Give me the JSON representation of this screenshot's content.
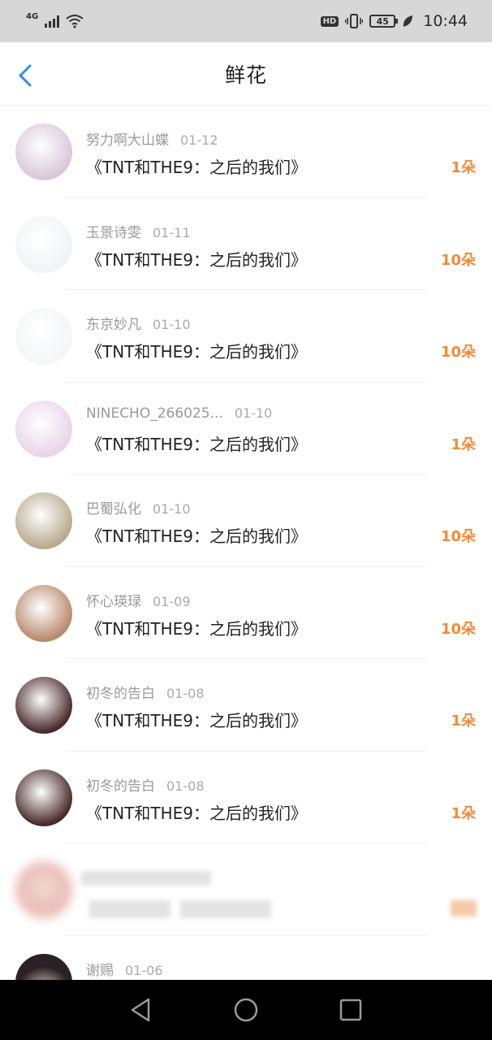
{
  "status_bar": {
    "network": "4G",
    "hd": "HD",
    "battery": "45",
    "time": "10:44"
  },
  "header": {
    "title": "鲜花"
  },
  "rows": [
    {
      "user": "努力啊大山蝶",
      "date": "01-12",
      "book": "《TNT和THE9：之后的我们》",
      "flowers": "1朵",
      "avatar_color": "#d8c7d8"
    },
    {
      "user": "玉景诗雯",
      "date": "01-11",
      "book": "《TNT和THE9：之后的我们》",
      "flowers": "10朵",
      "avatar_color": "#eef4f7"
    },
    {
      "user": "东京妙凡",
      "date": "01-10",
      "book": "《TNT和THE9：之后的我们》",
      "flowers": "10朵",
      "avatar_color": "#f3f5f8"
    },
    {
      "user": "NINECHO_266025...",
      "date": "01-10",
      "book": "《TNT和THE9：之后的我们》",
      "flowers": "1朵",
      "avatar_color": "#e9d4e8"
    },
    {
      "user": "巴蜀弘化",
      "date": "01-10",
      "book": "《TNT和THE9：之后的我们》",
      "flowers": "10朵",
      "avatar_color": "#b8aa8c"
    },
    {
      "user": "怀心瑛琭",
      "date": "01-09",
      "book": "《TNT和THE9：之后的我们》",
      "flowers": "10朵",
      "avatar_color": "#b98a6c"
    },
    {
      "user": "初冬的告白",
      "date": "01-08",
      "book": "《TNT和THE9：之后的我们》",
      "flowers": "1朵",
      "avatar_color": "#4a2a2a"
    },
    {
      "user": "初冬的告白",
      "date": "01-08",
      "book": "《TNT和THE9：之后的我们》",
      "flowers": "1朵",
      "avatar_color": "#4a2a2a"
    }
  ],
  "partial_row": {
    "user": "谢赐",
    "date": "01-06"
  },
  "colors": {
    "accent_blue": "#2f8ce6",
    "flower_orange": "#f08b3a"
  }
}
